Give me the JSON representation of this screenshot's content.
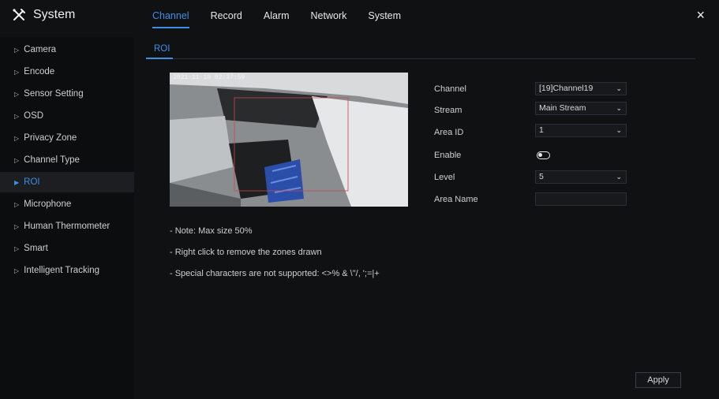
{
  "app": {
    "title": "System",
    "icon": "tools-icon"
  },
  "tabs": [
    {
      "label": "Channel"
    },
    {
      "label": "Record"
    },
    {
      "label": "Alarm"
    },
    {
      "label": "Network"
    },
    {
      "label": "System"
    }
  ],
  "close_icon": "×",
  "sidebar": {
    "items": [
      {
        "label": "Camera"
      },
      {
        "label": "Encode"
      },
      {
        "label": "Sensor Setting"
      },
      {
        "label": "OSD"
      },
      {
        "label": "Privacy Zone"
      },
      {
        "label": "Channel Type"
      },
      {
        "label": "ROI"
      },
      {
        "label": "Microphone"
      },
      {
        "label": "Human Thermometer"
      },
      {
        "label": "Smart"
      },
      {
        "label": "Intelligent Tracking"
      }
    ],
    "active_index": 6
  },
  "subtab": {
    "label": "ROI"
  },
  "video": {
    "osd_text": "2021-11-10  02:37:59"
  },
  "notes": [
    "- Note: Max size 50%",
    "- Right click to remove the zones drawn",
    "- Special characters are not supported: <>% & \\\"/, ';=|+"
  ],
  "form": {
    "channel": {
      "label": "Channel",
      "value": "[19]Channel19"
    },
    "stream": {
      "label": "Stream",
      "value": "Main Stream"
    },
    "area_id": {
      "label": "Area ID",
      "value": "1"
    },
    "enable": {
      "label": "Enable",
      "on": false
    },
    "level": {
      "label": "Level",
      "value": "5"
    },
    "area_name": {
      "label": "Area Name",
      "value": ""
    }
  },
  "apply_label": "Apply",
  "colors": {
    "accent": "#3d8fe6",
    "background": "#101113",
    "sidebar_active": "#1c1e22"
  }
}
